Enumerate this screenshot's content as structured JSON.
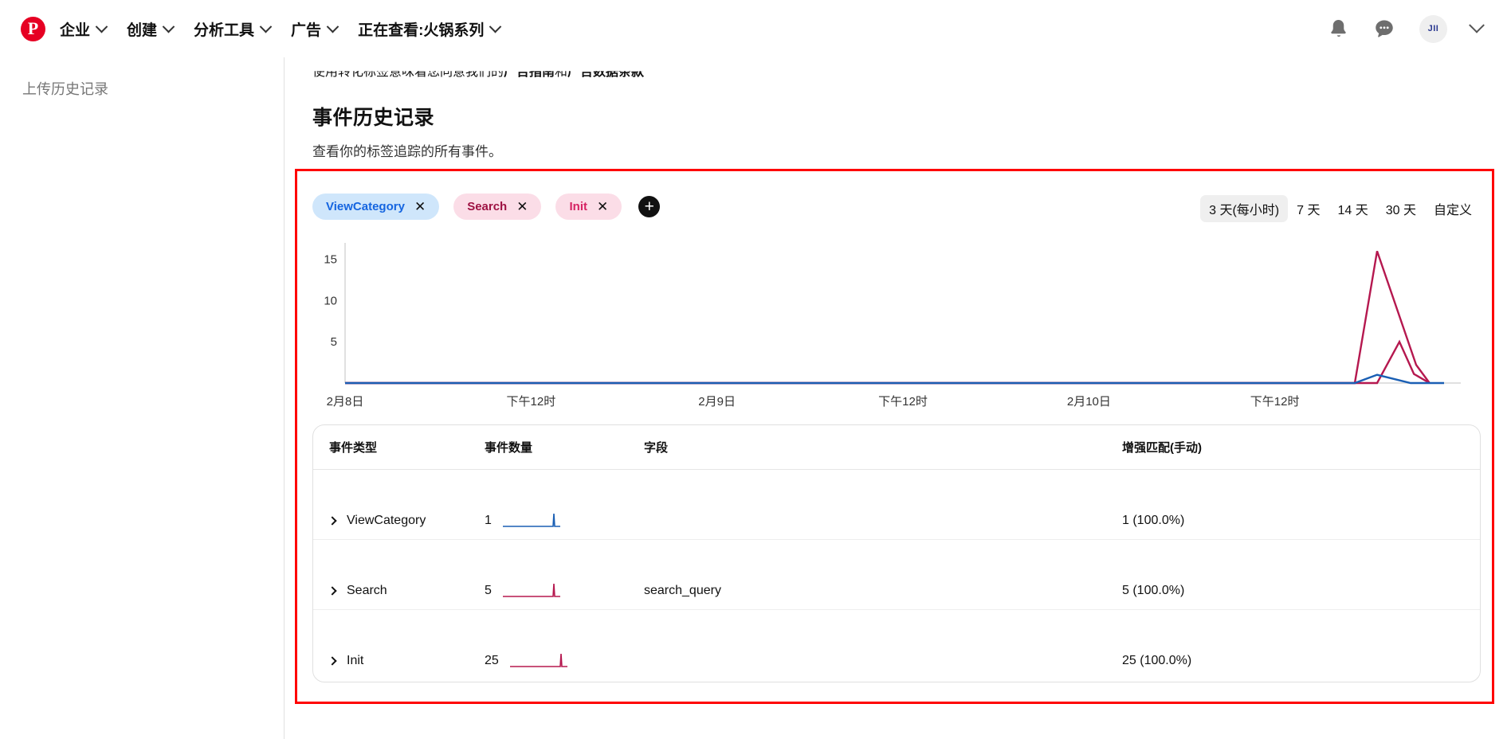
{
  "topnav": {
    "logo": "P",
    "items": [
      {
        "label": "企业",
        "icon": "chevron-down-icon"
      },
      {
        "label": "创建",
        "icon": "chevron-down-icon"
      },
      {
        "label": "分析工具",
        "icon": "chevron-down-icon"
      },
      {
        "label": "广告",
        "icon": "chevron-down-icon"
      },
      {
        "label": "正在查看:火锅系列",
        "icon": "chevron-down-icon"
      }
    ],
    "notifications_icon": "bell-icon",
    "messages_icon": "chat-bubble-icon",
    "avatar_initials": "JII",
    "account_menu_icon": "chevron-down-icon"
  },
  "sidebar": {
    "items": [
      {
        "label": "上传历史记录"
      }
    ]
  },
  "main": {
    "legal_prefix": "使用转化标签意味着您同意我们的",
    "legal_link1": "广告指南",
    "legal_mid": "和",
    "legal_link2": "广告数据条款",
    "title": "事件历史记录",
    "subtitle": "查看你的标签追踪的所有事件。"
  },
  "filters": {
    "chips": [
      {
        "label": "ViewCategory",
        "close": "✕",
        "color": "#1565e0",
        "bg": "#cfe6fb"
      },
      {
        "label": "Search",
        "close": "✕",
        "color": "#9e1243",
        "bg": "#fbdde7"
      },
      {
        "label": "Init",
        "close": "✕",
        "color": "#d62263",
        "bg": "#fbdde7"
      }
    ],
    "add_label": "+"
  },
  "date_range": {
    "options": [
      {
        "label": "3 天(每小时)",
        "selected": true
      },
      {
        "label": "7 天",
        "selected": false
      },
      {
        "label": "14 天",
        "selected": false
      },
      {
        "label": "30 天",
        "selected": false
      },
      {
        "label": "自定义",
        "selected": false
      }
    ]
  },
  "chart_data": {
    "type": "line",
    "title": "",
    "xlabel": "",
    "ylabel": "",
    "ylim": [
      0,
      17
    ],
    "yticks": [
      5,
      10,
      15
    ],
    "ytick_labels": [
      "5",
      "10",
      "15"
    ],
    "xtick_labels": [
      "2月8日",
      "下午12时",
      "2月9日",
      "下午12时",
      "2月10日",
      "下午12时"
    ],
    "xtick_positions": [
      0,
      0.1667,
      0.3333,
      0.5,
      0.6667,
      0.8333
    ],
    "grid": false,
    "legend": "none",
    "series": [
      {
        "name": "Init",
        "color": "#b5184f",
        "points": [
          [
            0.0,
            0
          ],
          [
            0.88,
            0
          ],
          [
            0.905,
            0
          ],
          [
            0.925,
            16.0
          ],
          [
            0.96,
            2.2
          ],
          [
            0.972,
            0
          ]
        ]
      },
      {
        "name": "Search",
        "color": "#b5184f",
        "points": [
          [
            0.0,
            0
          ],
          [
            0.925,
            0
          ],
          [
            0.945,
            5.0
          ],
          [
            0.958,
            1.1
          ],
          [
            0.972,
            0
          ]
        ]
      },
      {
        "name": "ViewCategory",
        "color": "#1a5fb4",
        "points": [
          [
            0.0,
            0
          ],
          [
            0.905,
            0
          ],
          [
            0.925,
            1.0
          ],
          [
            0.955,
            0
          ],
          [
            0.985,
            0
          ]
        ]
      }
    ]
  },
  "table": {
    "headers": [
      "事件类型",
      "事件数量",
      "字段",
      "增强匹配(手动)"
    ],
    "rows": [
      {
        "type": "ViewCategory",
        "count": "1",
        "field": "",
        "match": "1 (100.0%)",
        "spark_color": "#1a5fb4"
      },
      {
        "type": "Search",
        "count": "5",
        "field": "search_query",
        "match": "5 (100.0%)",
        "spark_color": "#b5184f"
      },
      {
        "type": "Init",
        "count": "25",
        "field": "",
        "match": "25 (100.0%)",
        "spark_color": "#b5184f"
      }
    ]
  }
}
